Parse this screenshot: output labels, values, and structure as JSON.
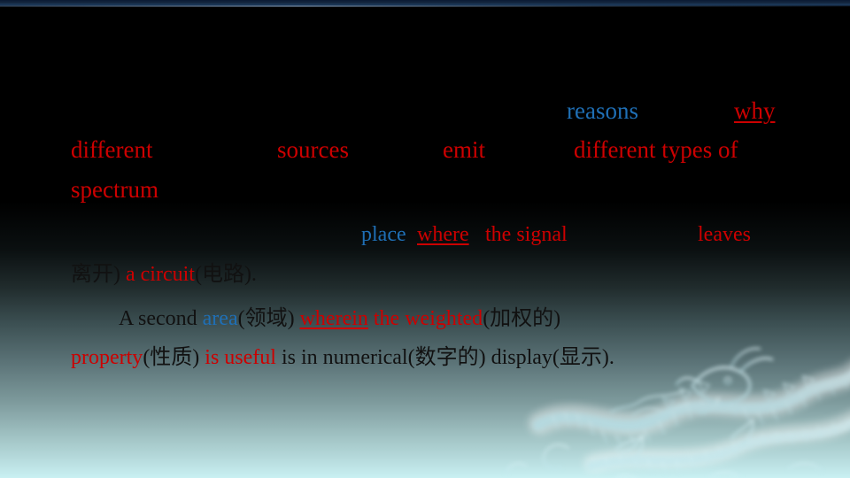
{
  "slide": {
    "background": {
      "top_color": "#000000",
      "bottom_color": "#c9f0f2",
      "accent_band_color": "#1d3c5e",
      "watermark": "chinese-dragon"
    },
    "colors": {
      "red": "#cc0000",
      "blue": "#1f6fb5",
      "dark": "#111111"
    },
    "lines": [
      {
        "id": "line-reasons",
        "segments": [
          {
            "text": "reasons",
            "color": "blue",
            "underline": false
          },
          {
            "text": "why",
            "color": "red",
            "underline": true
          }
        ]
      },
      {
        "id": "line-different-sources",
        "segments": [
          {
            "text": "different",
            "color": "red",
            "underline": false
          },
          {
            "text": "sources",
            "color": "red",
            "underline": false
          },
          {
            "text": "emit",
            "color": "red",
            "underline": false
          },
          {
            "text": "different types of",
            "color": "red",
            "underline": false
          }
        ]
      },
      {
        "id": "line-spectrum",
        "segments": [
          {
            "text": "spectrum",
            "color": "red",
            "underline": false
          }
        ]
      },
      {
        "id": "line-place-where",
        "segments": [
          {
            "text": "place ",
            "color": "blue",
            "underline": false
          },
          {
            "text": "where",
            "color": "red",
            "underline": true
          },
          {
            "text": " the signal",
            "color": "red",
            "underline": false
          },
          {
            "text": "leaves",
            "color": "red",
            "underline": false
          }
        ]
      },
      {
        "id": "line-circuit",
        "segments": [
          {
            "text": "离开) ",
            "color": "dark",
            "underline": false
          },
          {
            "text": "a circuit",
            "color": "red",
            "underline": false
          },
          {
            "text": "(电路).",
            "color": "dark",
            "underline": false
          }
        ]
      },
      {
        "id": "line-second-area",
        "segments": [
          {
            "text": "A second ",
            "color": "dark",
            "underline": false
          },
          {
            "text": "area",
            "color": "blue",
            "underline": false
          },
          {
            "text": "(领域) ",
            "color": "dark",
            "underline": false
          },
          {
            "text": "wherein",
            "color": "red",
            "underline": true
          },
          {
            "text": " the weighted",
            "color": "red",
            "underline": false
          },
          {
            "text": "(加权的)",
            "color": "dark",
            "underline": false
          }
        ]
      },
      {
        "id": "line-property",
        "segments": [
          {
            "text": "property",
            "color": "red",
            "underline": false
          },
          {
            "text": "(性质) ",
            "color": "dark",
            "underline": false
          },
          {
            "text": "is useful",
            "color": "red",
            "underline": false
          },
          {
            "text": " is in numerical(数字的) display(显示).",
            "color": "dark",
            "underline": false
          }
        ]
      }
    ],
    "text": {
      "reasons": "reasons",
      "why": "why",
      "different": "different",
      "sources": "sources",
      "emit": "emit",
      "different_types_of": "different types of",
      "spectrum": "spectrum",
      "place": "place ",
      "where": "where",
      "the_signal": " the signal",
      "leaves": "leaves",
      "leave_cn": "离开) ",
      "a_circuit": "a circuit",
      "circuit_cn": "(电路).",
      "a_second": "A second ",
      "area": "area",
      "area_cn": "(领域) ",
      "wherein": "wherein",
      "the_weighted": " the weighted",
      "weighted_cn": "(加权的)",
      "property": "property",
      "property_cn": "(性质) ",
      "is_useful": "is useful",
      "tail": " is in numerical(数字的) display(显示)."
    }
  }
}
